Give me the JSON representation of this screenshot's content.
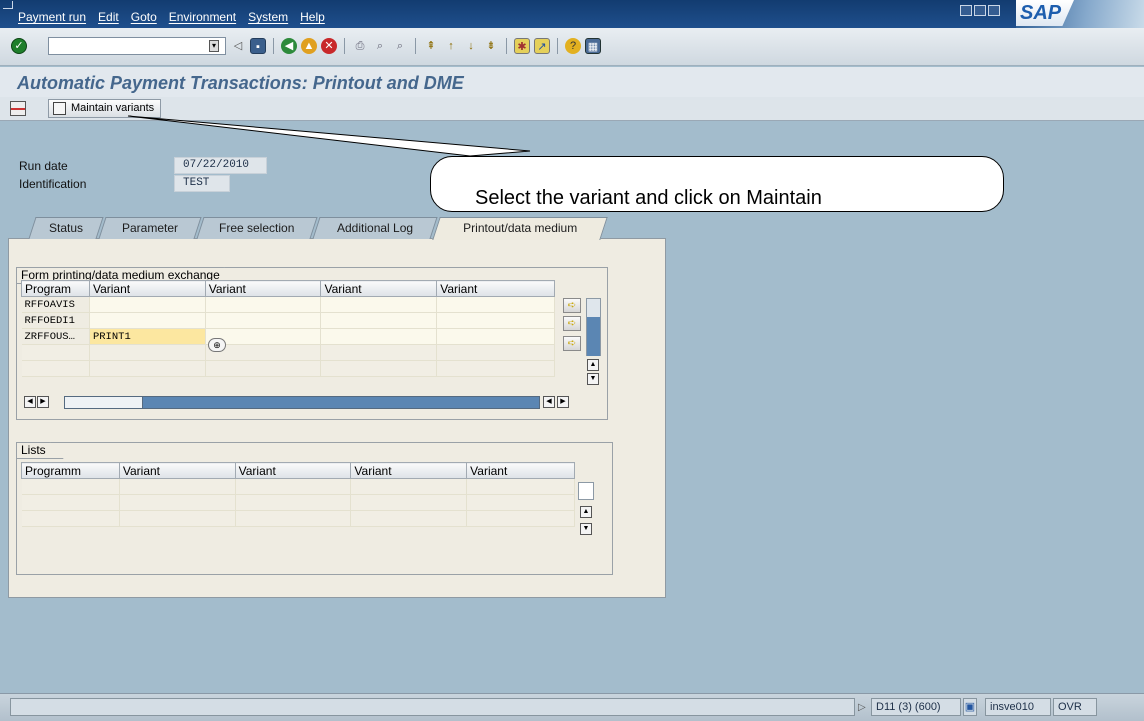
{
  "menu": [
    "Payment run",
    "Edit",
    "Goto",
    "Environment",
    "System",
    "Help"
  ],
  "logo": "SAP",
  "page_title": "Automatic Payment Transactions: Printout and DME",
  "app_toolbar": {
    "maintain_label": "Maintain variants"
  },
  "header": {
    "run_date_label": "Run date",
    "run_date_value": "07/22/2010",
    "identification_label": "Identification",
    "identification_value": "TEST"
  },
  "callout_text": "Select the variant and click on Maintain",
  "tabs": [
    "Status",
    "Parameter",
    "Free selection",
    "Additional Log",
    "Printout/data medium"
  ],
  "form_group": {
    "title": "Form printing/data medium exchange",
    "columns": [
      "Program",
      "Variant",
      "Variant",
      "Variant",
      "Variant"
    ],
    "rows": [
      {
        "program": "RFFOAVIS",
        "variant": ""
      },
      {
        "program": "RFFOEDI1",
        "variant": ""
      },
      {
        "program": "ZRFFOUS…",
        "variant": "PRINT1"
      }
    ]
  },
  "lists_group": {
    "title": "Lists",
    "columns": [
      "Programm",
      "Variant",
      "Variant",
      "Variant",
      "Variant"
    ]
  },
  "status_bar": {
    "system": "D11 (3) (600)",
    "server": "insve010",
    "mode": "OVR"
  },
  "colors": {
    "title": "#45678d",
    "menubar": "#1f4f8c",
    "highlight": "#fce7a0"
  }
}
